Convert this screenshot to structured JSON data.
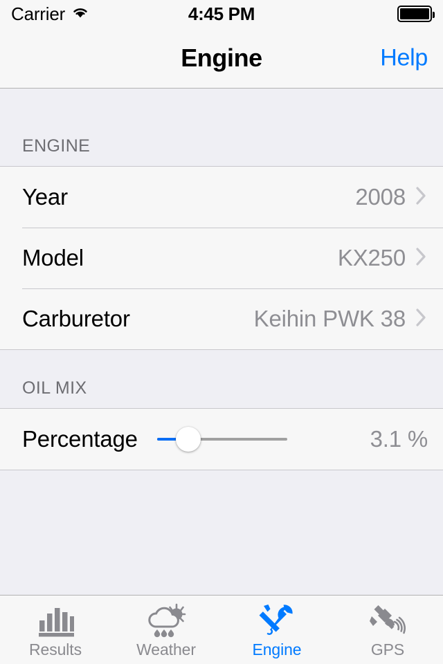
{
  "status_bar": {
    "carrier": "Carrier",
    "wifi_icon": "wifi-icon",
    "time": "4:45 PM",
    "battery_icon": "battery-full-icon"
  },
  "nav_bar": {
    "title": "Engine",
    "right_button": "Help",
    "accent_color": "#007AFF"
  },
  "sections": [
    {
      "header": "ENGINE",
      "rows": [
        {
          "label": "Year",
          "value": "2008",
          "accessory": "chevron-right-icon"
        },
        {
          "label": "Model",
          "value": "KX250",
          "accessory": "chevron-right-icon"
        },
        {
          "label": "Carburetor",
          "value": "Keihin PWK 38",
          "accessory": "chevron-right-icon"
        }
      ]
    },
    {
      "header": "OIL MIX",
      "slider_row": {
        "label": "Percentage",
        "value_text": "3.1 %",
        "slider": {
          "value": 3.1,
          "fill_percent": 24,
          "min_track_color": "#0B6EF5",
          "max_track_color": "#A0A0A0",
          "thumb_color": "#FFFFFF"
        }
      }
    }
  ],
  "tab_bar": {
    "items": [
      {
        "label": "Results",
        "icon": "bar-chart-icon",
        "active": false
      },
      {
        "label": "Weather",
        "icon": "cloud-sun-rain-icon",
        "active": false
      },
      {
        "label": "Engine",
        "icon": "wrench-screwdriver-icon",
        "active": true
      },
      {
        "label": "GPS",
        "icon": "satellite-icon",
        "active": false
      }
    ],
    "active_color": "#007AFF",
    "inactive_color": "#8A8A8F"
  }
}
